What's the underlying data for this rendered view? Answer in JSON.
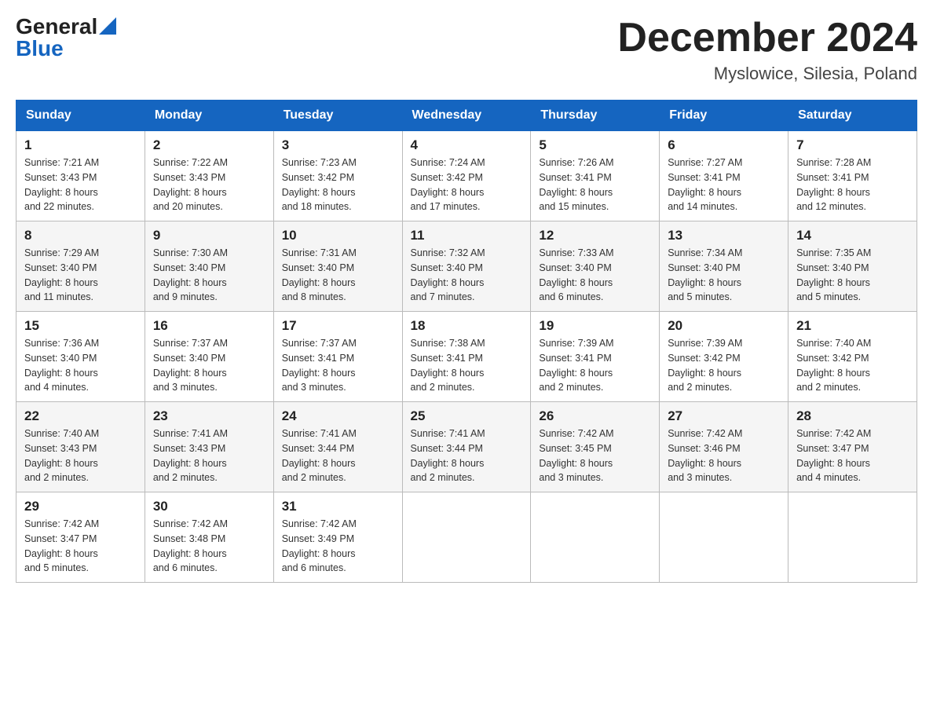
{
  "header": {
    "logo_general": "General",
    "logo_blue": "Blue",
    "month_year": "December 2024",
    "location": "Myslowice, Silesia, Poland"
  },
  "days_of_week": [
    "Sunday",
    "Monday",
    "Tuesday",
    "Wednesday",
    "Thursday",
    "Friday",
    "Saturday"
  ],
  "weeks": [
    [
      {
        "day": "1",
        "sunrise": "7:21 AM",
        "sunset": "3:43 PM",
        "daylight": "8 hours and 22 minutes."
      },
      {
        "day": "2",
        "sunrise": "7:22 AM",
        "sunset": "3:43 PM",
        "daylight": "8 hours and 20 minutes."
      },
      {
        "day": "3",
        "sunrise": "7:23 AM",
        "sunset": "3:42 PM",
        "daylight": "8 hours and 18 minutes."
      },
      {
        "day": "4",
        "sunrise": "7:24 AM",
        "sunset": "3:42 PM",
        "daylight": "8 hours and 17 minutes."
      },
      {
        "day": "5",
        "sunrise": "7:26 AM",
        "sunset": "3:41 PM",
        "daylight": "8 hours and 15 minutes."
      },
      {
        "day": "6",
        "sunrise": "7:27 AM",
        "sunset": "3:41 PM",
        "daylight": "8 hours and 14 minutes."
      },
      {
        "day": "7",
        "sunrise": "7:28 AM",
        "sunset": "3:41 PM",
        "daylight": "8 hours and 12 minutes."
      }
    ],
    [
      {
        "day": "8",
        "sunrise": "7:29 AM",
        "sunset": "3:40 PM",
        "daylight": "8 hours and 11 minutes."
      },
      {
        "day": "9",
        "sunrise": "7:30 AM",
        "sunset": "3:40 PM",
        "daylight": "8 hours and 9 minutes."
      },
      {
        "day": "10",
        "sunrise": "7:31 AM",
        "sunset": "3:40 PM",
        "daylight": "8 hours and 8 minutes."
      },
      {
        "day": "11",
        "sunrise": "7:32 AM",
        "sunset": "3:40 PM",
        "daylight": "8 hours and 7 minutes."
      },
      {
        "day": "12",
        "sunrise": "7:33 AM",
        "sunset": "3:40 PM",
        "daylight": "8 hours and 6 minutes."
      },
      {
        "day": "13",
        "sunrise": "7:34 AM",
        "sunset": "3:40 PM",
        "daylight": "8 hours and 5 minutes."
      },
      {
        "day": "14",
        "sunrise": "7:35 AM",
        "sunset": "3:40 PM",
        "daylight": "8 hours and 5 minutes."
      }
    ],
    [
      {
        "day": "15",
        "sunrise": "7:36 AM",
        "sunset": "3:40 PM",
        "daylight": "8 hours and 4 minutes."
      },
      {
        "day": "16",
        "sunrise": "7:37 AM",
        "sunset": "3:40 PM",
        "daylight": "8 hours and 3 minutes."
      },
      {
        "day": "17",
        "sunrise": "7:37 AM",
        "sunset": "3:41 PM",
        "daylight": "8 hours and 3 minutes."
      },
      {
        "day": "18",
        "sunrise": "7:38 AM",
        "sunset": "3:41 PM",
        "daylight": "8 hours and 2 minutes."
      },
      {
        "day": "19",
        "sunrise": "7:39 AM",
        "sunset": "3:41 PM",
        "daylight": "8 hours and 2 minutes."
      },
      {
        "day": "20",
        "sunrise": "7:39 AM",
        "sunset": "3:42 PM",
        "daylight": "8 hours and 2 minutes."
      },
      {
        "day": "21",
        "sunrise": "7:40 AM",
        "sunset": "3:42 PM",
        "daylight": "8 hours and 2 minutes."
      }
    ],
    [
      {
        "day": "22",
        "sunrise": "7:40 AM",
        "sunset": "3:43 PM",
        "daylight": "8 hours and 2 minutes."
      },
      {
        "day": "23",
        "sunrise": "7:41 AM",
        "sunset": "3:43 PM",
        "daylight": "8 hours and 2 minutes."
      },
      {
        "day": "24",
        "sunrise": "7:41 AM",
        "sunset": "3:44 PM",
        "daylight": "8 hours and 2 minutes."
      },
      {
        "day": "25",
        "sunrise": "7:41 AM",
        "sunset": "3:44 PM",
        "daylight": "8 hours and 2 minutes."
      },
      {
        "day": "26",
        "sunrise": "7:42 AM",
        "sunset": "3:45 PM",
        "daylight": "8 hours and 3 minutes."
      },
      {
        "day": "27",
        "sunrise": "7:42 AM",
        "sunset": "3:46 PM",
        "daylight": "8 hours and 3 minutes."
      },
      {
        "day": "28",
        "sunrise": "7:42 AM",
        "sunset": "3:47 PM",
        "daylight": "8 hours and 4 minutes."
      }
    ],
    [
      {
        "day": "29",
        "sunrise": "7:42 AM",
        "sunset": "3:47 PM",
        "daylight": "8 hours and 5 minutes."
      },
      {
        "day": "30",
        "sunrise": "7:42 AM",
        "sunset": "3:48 PM",
        "daylight": "8 hours and 6 minutes."
      },
      {
        "day": "31",
        "sunrise": "7:42 AM",
        "sunset": "3:49 PM",
        "daylight": "8 hours and 6 minutes."
      },
      null,
      null,
      null,
      null
    ]
  ],
  "labels": {
    "sunrise": "Sunrise:",
    "sunset": "Sunset:",
    "daylight": "Daylight:"
  }
}
